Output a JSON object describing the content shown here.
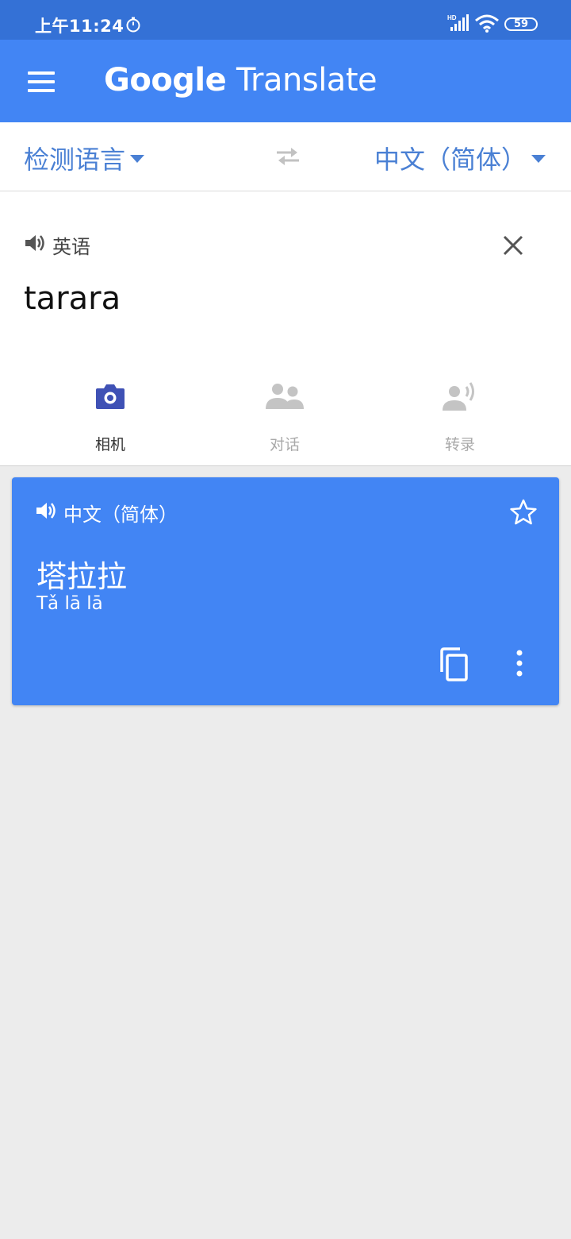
{
  "status_bar": {
    "time": "上午11:24",
    "network": "HD",
    "battery": "59"
  },
  "app_bar": {
    "brand": "Google",
    "title": "Translate"
  },
  "languages": {
    "source": "检测语言",
    "target": "中文（简体）"
  },
  "input": {
    "detected_language": "英语",
    "text": "tarara"
  },
  "tools": [
    {
      "label": "相机",
      "icon": "camera-icon"
    },
    {
      "label": "对话",
      "icon": "conversation-icon"
    },
    {
      "label": "转录",
      "icon": "transcribe-icon"
    }
  ],
  "result": {
    "language": "中文（简体）",
    "text": "塔拉拉",
    "pinyin": "Tǎ lā lā"
  },
  "colors": {
    "primary": "#4285f4",
    "status_bar": "#3471d6",
    "accent_text": "#4a80d4",
    "camera_icon": "#3f51b5"
  }
}
